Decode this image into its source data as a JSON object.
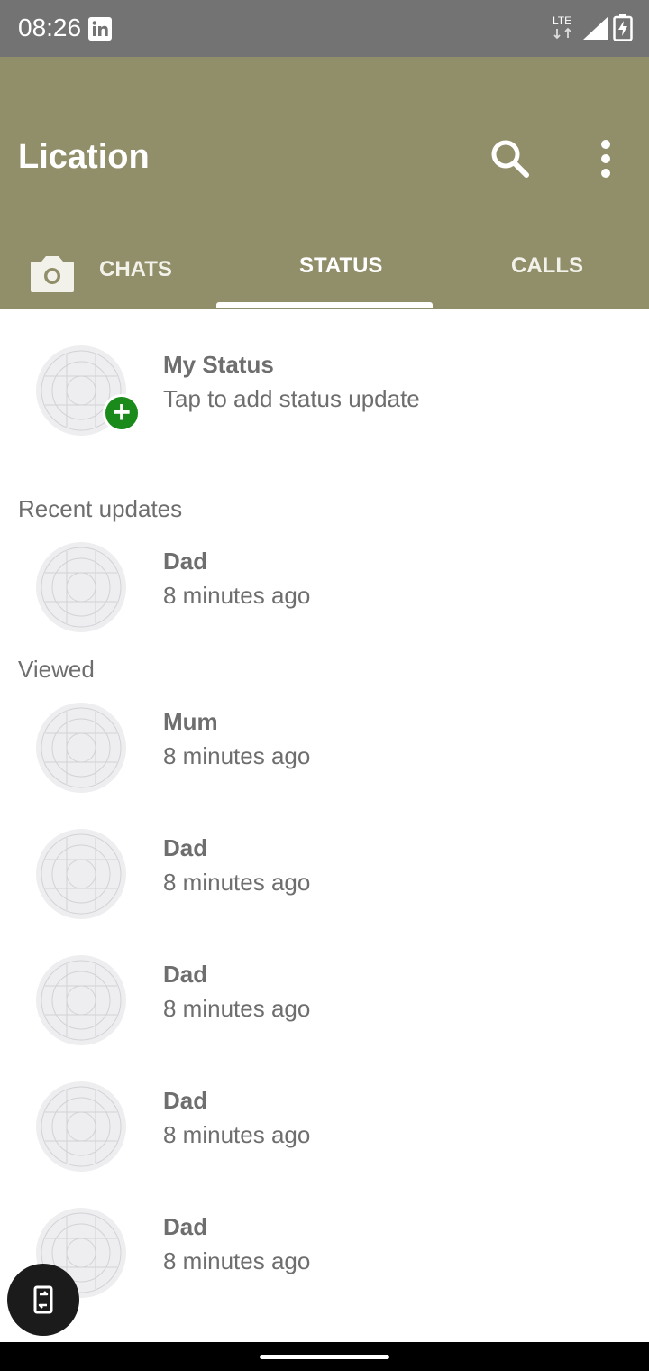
{
  "status_bar": {
    "time": "08:26",
    "network_label": "LTE",
    "icons": [
      "linkedin-icon",
      "lte-icon",
      "signal-icon",
      "battery-charging-icon"
    ]
  },
  "app_bar": {
    "title": "Lication",
    "accent_color": "#918e6a",
    "actions": [
      "search-icon",
      "more-vert-icon"
    ]
  },
  "tabs": {
    "camera_icon": "camera-icon",
    "chats": "CHATS",
    "status": "STATUS",
    "calls": "CALLS",
    "selected": "STATUS"
  },
  "my_status": {
    "name": "My Status",
    "subtitle": "Tap to add status update",
    "badge_color": "#1a8a1a"
  },
  "sections": {
    "recent": "Recent updates",
    "viewed": "Viewed"
  },
  "recent_updates": [
    {
      "name": "Dad",
      "time": "8 minutes ago"
    }
  ],
  "viewed_updates": [
    {
      "name": "Mum",
      "time": "8 minutes ago"
    },
    {
      "name": "Dad",
      "time": "8 minutes ago"
    },
    {
      "name": "Dad",
      "time": "8 minutes ago"
    },
    {
      "name": "Dad",
      "time": "8 minutes ago"
    },
    {
      "name": "Dad",
      "time": "8 minutes ago"
    }
  ],
  "fab": {
    "icon": "rotate-screen-icon"
  }
}
